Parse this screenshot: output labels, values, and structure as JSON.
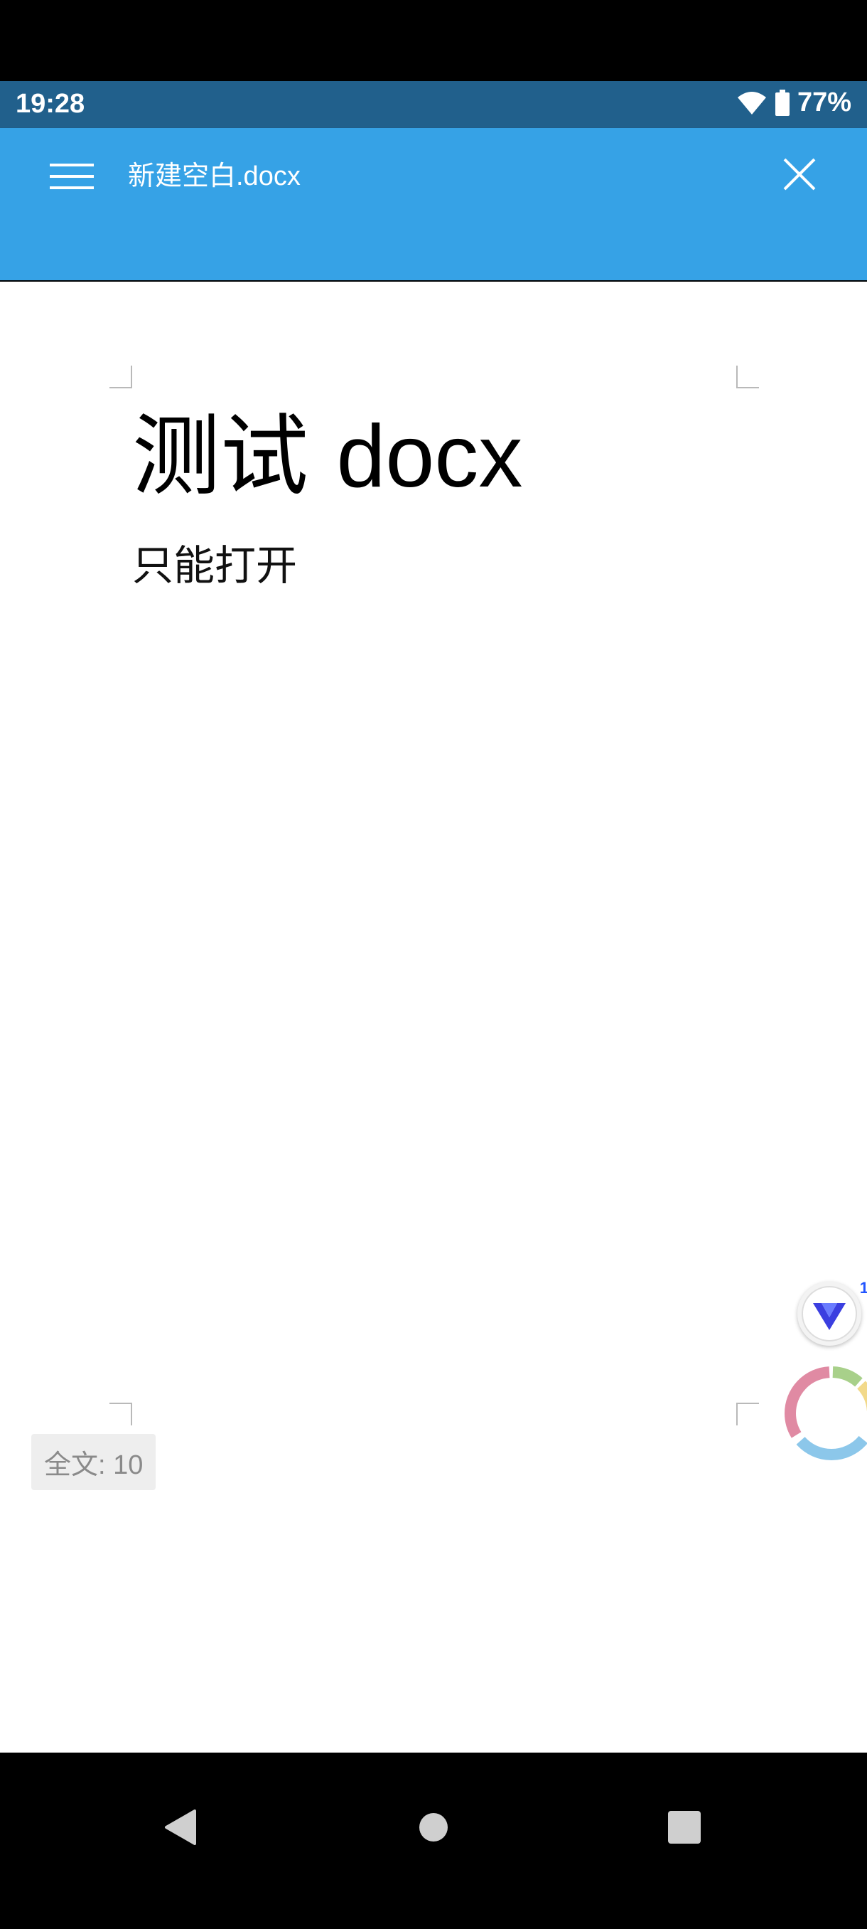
{
  "status_bar": {
    "time": "19:28",
    "battery": "77%",
    "wifi_icon": "wifi-icon",
    "battery_icon": "battery-icon"
  },
  "app_bar": {
    "title": "新建空白.docx",
    "menu_icon": "hamburger-menu-icon",
    "close_icon": "close-icon"
  },
  "document": {
    "title_cjk": "测试",
    "title_latin": "docx",
    "body": "只能打开"
  },
  "word_count": "全文: 10",
  "floating": {
    "v_badge": "1"
  },
  "colors": {
    "status_bar": "#21608C",
    "app_bar": "#36A2E6",
    "page": "#FFFFFF"
  },
  "nav_bar": {
    "back_icon": "back-triangle-icon",
    "home_icon": "home-circle-icon",
    "recents_icon": "recents-square-icon"
  }
}
